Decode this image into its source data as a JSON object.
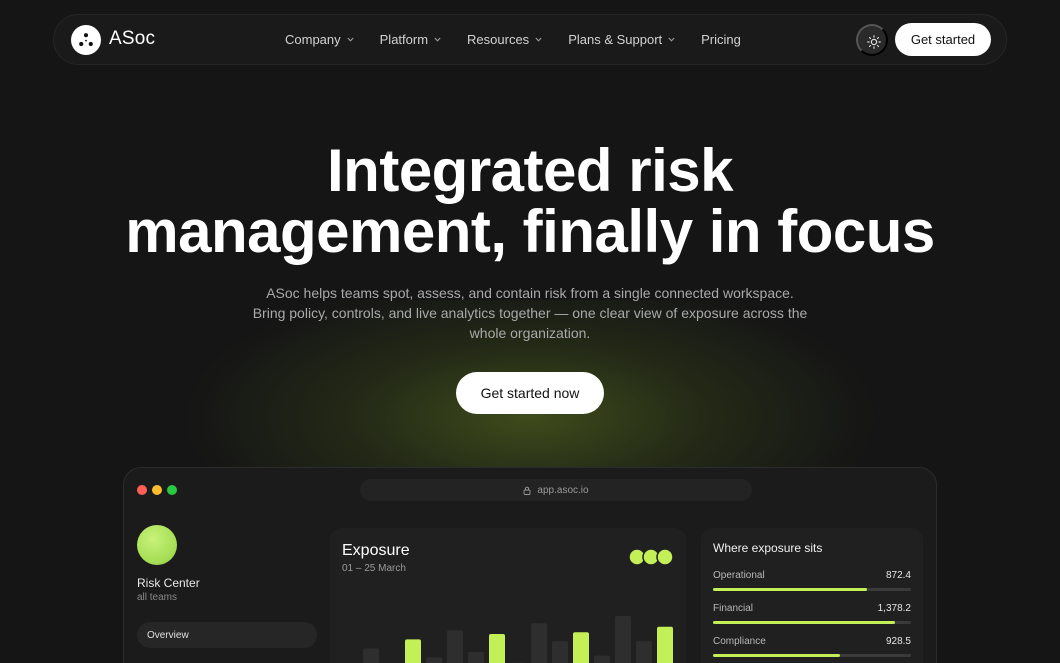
{
  "brand": {
    "name": "ASoc"
  },
  "nav": {
    "items": [
      {
        "label": "Company",
        "dropdown": true
      },
      {
        "label": "Platform",
        "dropdown": true
      },
      {
        "label": "Resources",
        "dropdown": true
      },
      {
        "label": "Plans & Support",
        "dropdown": true
      },
      {
        "label": "Pricing",
        "dropdown": false
      }
    ],
    "theme_icon": "sun-icon",
    "cta_label": "Get started"
  },
  "hero": {
    "title_line1": "Integrated risk",
    "title_line2": "management, finally in focus",
    "subtitle_line1": "ASoc helps teams spot, assess, and contain risk from a single connected workspace.",
    "subtitle_line2": "Bring policy, controls, and live analytics together — one clear view of exposure across the",
    "subtitle_line3": "whole organization.",
    "cta_label": "Get started now"
  },
  "app_window": {
    "url": "app.asoc.io",
    "window_dots": [
      "#ff5f57",
      "#febc2e",
      "#28c840"
    ],
    "sidebar": {
      "title": "Risk Center",
      "subtitle": "all teams",
      "items": [
        {
          "label": "Overview",
          "active": true
        }
      ]
    },
    "exposure": {
      "title": "Exposure",
      "date_range": "01 – 25 March",
      "bars": [
        {
          "value": 0.12,
          "highlight": false
        },
        {
          "value": 0.22,
          "highlight": false
        },
        {
          "value": 0.08,
          "highlight": false
        },
        {
          "value": 0.27,
          "highlight": true
        },
        {
          "value": 0.17,
          "highlight": false
        },
        {
          "value": 0.32,
          "highlight": false
        },
        {
          "value": 0.2,
          "highlight": false
        },
        {
          "value": 0.3,
          "highlight": true
        },
        {
          "value": 0.14,
          "highlight": false
        },
        {
          "value": 0.36,
          "highlight": false
        },
        {
          "value": 0.26,
          "highlight": false
        },
        {
          "value": 0.31,
          "highlight": true
        },
        {
          "value": 0.18,
          "highlight": false
        },
        {
          "value": 0.4,
          "highlight": false
        },
        {
          "value": 0.26,
          "highlight": false
        },
        {
          "value": 0.34,
          "highlight": true
        }
      ]
    },
    "where": {
      "title": "Where exposure sits",
      "metrics": [
        {
          "label": "Operational",
          "value": "872.4",
          "fill": 0.78
        },
        {
          "label": "Financial",
          "value": "1,378.2",
          "fill": 0.92
        },
        {
          "label": "Compliance",
          "value": "928.5",
          "fill": 0.64
        }
      ]
    }
  },
  "colors": {
    "background": "#151515",
    "accent": "#c3ef57",
    "bar_muted": "#2e2e2e",
    "card": "#202020"
  }
}
